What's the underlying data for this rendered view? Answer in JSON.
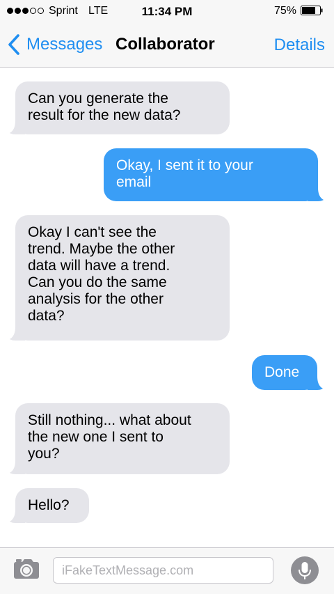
{
  "status_bar": {
    "carrier": "Sprint",
    "network": "LTE",
    "time": "11:34 PM",
    "battery_percent": "75%",
    "signal_bars_filled": 3,
    "signal_bars_total": 5,
    "battery_level": 0.75
  },
  "nav": {
    "back_label": "Messages",
    "title": "Collaborator",
    "details_label": "Details",
    "back_icon": "chevron-left-icon"
  },
  "messages": [
    {
      "direction": "incoming",
      "lines": [
        "Can you generate the",
        "result for the new data?"
      ]
    },
    {
      "direction": "outgoing",
      "lines": [
        "Okay, I sent it to your",
        "email"
      ]
    },
    {
      "direction": "incoming",
      "lines": [
        "Okay I can't see the",
        "trend. Maybe the other",
        "data will have a trend.",
        "Can you do the same",
        "analysis for the other",
        "data?"
      ]
    },
    {
      "direction": "outgoing",
      "lines": [
        "Done"
      ]
    },
    {
      "direction": "incoming",
      "lines": [
        "Still nothing... what about",
        "the new one I sent to",
        "you?"
      ]
    },
    {
      "direction": "incoming",
      "lines": [
        "Hello?"
      ]
    }
  ],
  "input_bar": {
    "placeholder": "iFakeTextMessage.com",
    "value": "",
    "camera_icon": "camera-icon",
    "mic_icon": "microphone-icon"
  },
  "colors": {
    "accent": "#1f8ef1",
    "outgoing_bubble": "#3a9ef6",
    "incoming_bubble": "#e5e5ea",
    "bar_background": "#f7f7f7"
  }
}
